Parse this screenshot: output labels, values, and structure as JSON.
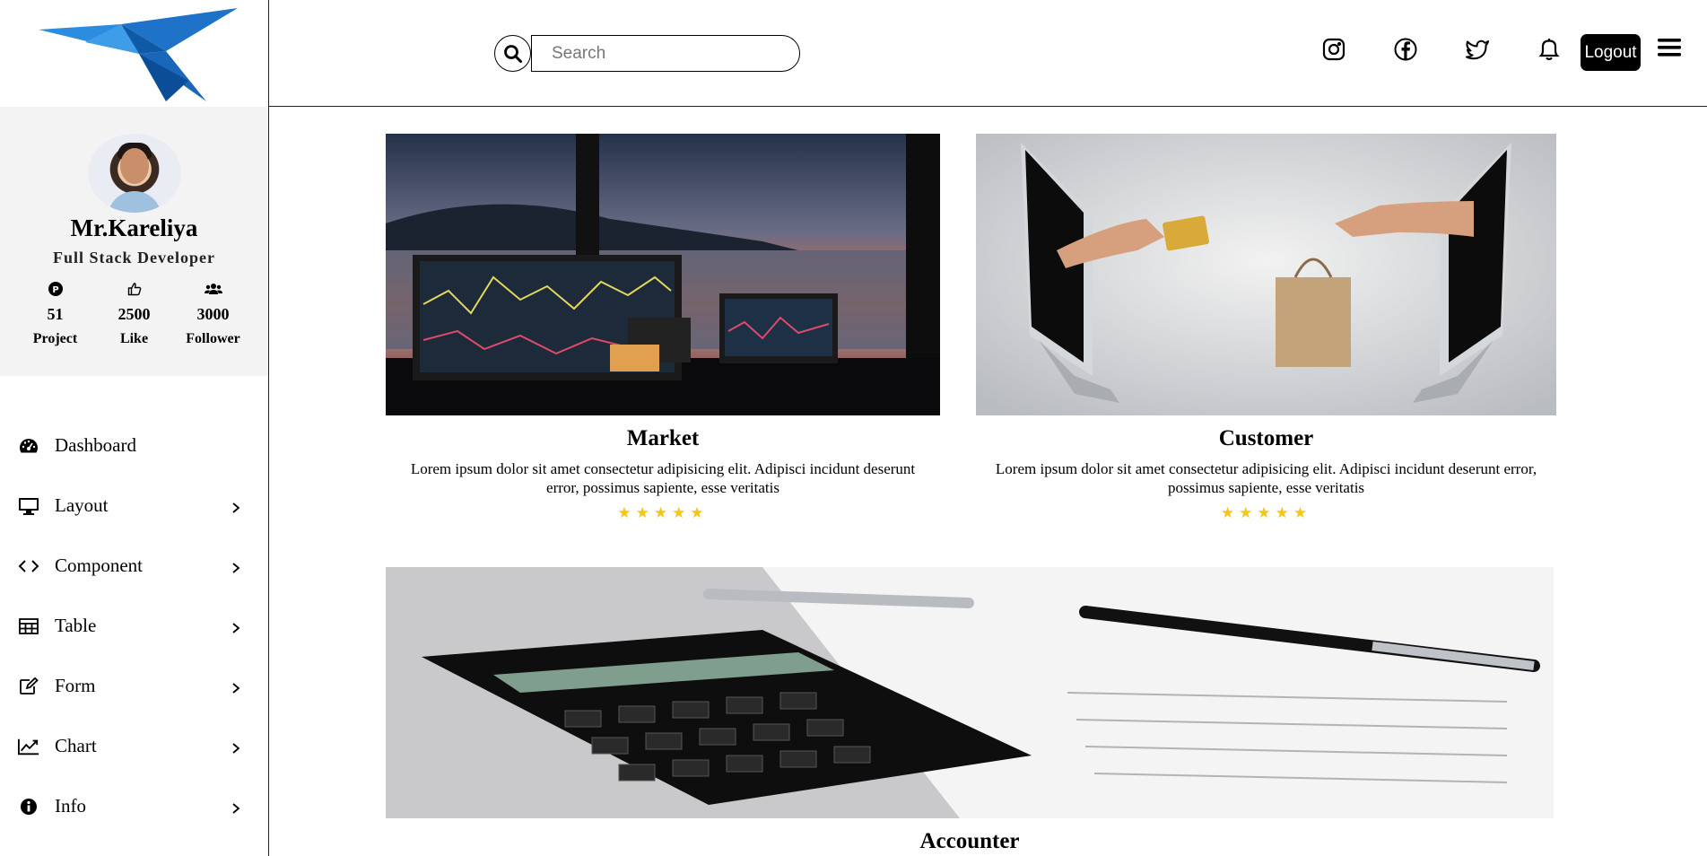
{
  "profile": {
    "name": "Mr.Kareliya",
    "role": "Full Stack Developer",
    "stats": [
      {
        "icon": "project-icon",
        "value": "51",
        "label": "Project"
      },
      {
        "icon": "like-icon",
        "value": "2500",
        "label": "Like"
      },
      {
        "icon": "followers-icon",
        "value": "3000",
        "label": "Follower"
      }
    ]
  },
  "menu": [
    {
      "label": "Dashboard",
      "icon": "dashboard-icon",
      "chevron": false
    },
    {
      "label": "Layout",
      "icon": "monitor-icon",
      "chevron": true
    },
    {
      "label": "Component",
      "icon": "code-icon",
      "chevron": true
    },
    {
      "label": "Table",
      "icon": "table-icon",
      "chevron": true
    },
    {
      "label": "Form",
      "icon": "edit-icon",
      "chevron": true
    },
    {
      "label": "Chart",
      "icon": "chart-line-icon",
      "chevron": true
    },
    {
      "label": "Info",
      "icon": "info-icon",
      "chevron": true
    }
  ],
  "header": {
    "search_placeholder": "Search",
    "icons": [
      "instagram-icon",
      "facebook-icon",
      "twitter-icon",
      "bell-icon",
      "hamburger-menu-icon"
    ],
    "logout_label": "Logout"
  },
  "cards": [
    {
      "title": "Market",
      "text": "Lorem ipsum dolor sit amet consectetur adipisicing elit. Adipisci incidunt deserunt error, possimus sapiente, esse veritatis",
      "stars": "★★★★★",
      "rating": 5
    },
    {
      "title": "Customer",
      "text": "Lorem ipsum dolor sit amet consectetur adipisicing elit. Adipisci incidunt deserunt error, possimus sapiente, esse veritatis",
      "stars": "★★★★★",
      "rating": 5
    },
    {
      "title": "Accounter"
    }
  ],
  "colors": {
    "star": "#f5c518",
    "logo": "#1e73c8",
    "sidebar_profile_bg": "#f3f3f3"
  }
}
